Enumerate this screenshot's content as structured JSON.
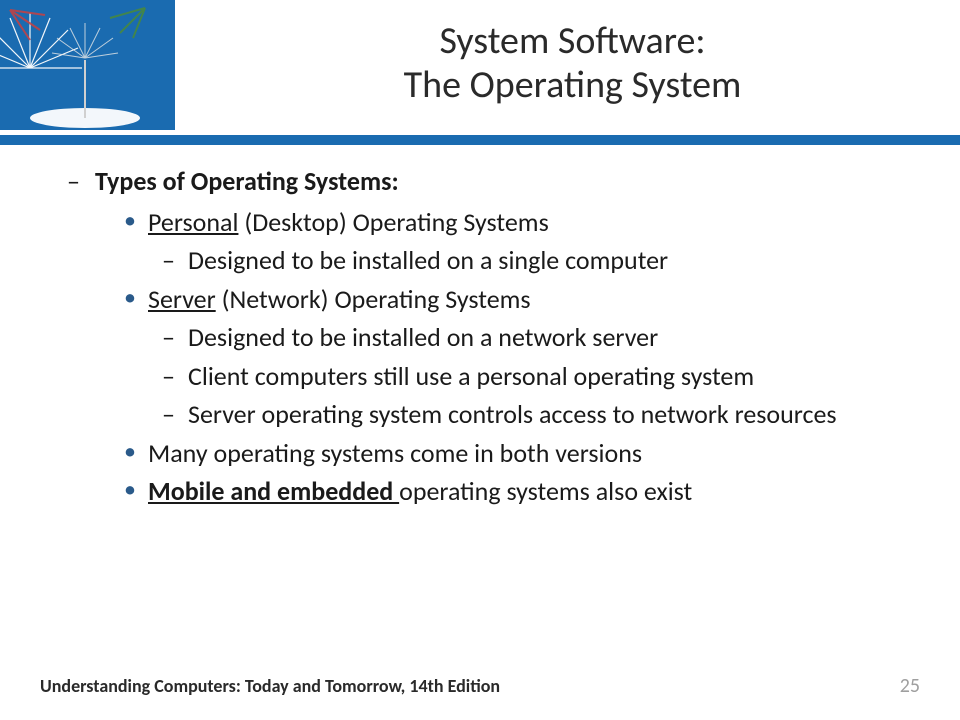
{
  "title": {
    "line1": "System Software:",
    "line2": "The Operating System"
  },
  "heading": "Types of Operating Systems:",
  "items": {
    "personal_u": "Personal",
    "personal_rest": " (Desktop) Operating Systems",
    "personal_sub1": "Designed to be installed on a single computer",
    "server_u": "Server",
    "server_rest": " (Network) Operating Systems",
    "server_sub1": "Designed to be installed on a network server",
    "server_sub2": "Client computers still use a personal operating system",
    "server_sub3": "Server operating system controls access to network resources",
    "many": "Many operating systems come in both versions",
    "mobile_u": "Mobile and embedded ",
    "mobile_rest": "operating systems also exist"
  },
  "footer": {
    "text": "Understanding Computers: Today and Tomorrow, 14th Edition",
    "page": "25"
  }
}
